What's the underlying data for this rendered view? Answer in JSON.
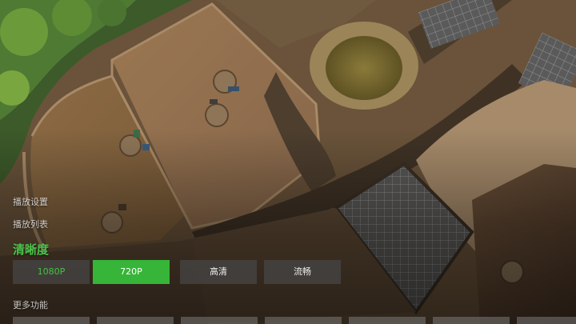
{
  "menu": {
    "playback_settings": "播放设置",
    "playlist": "播放列表",
    "resolution_title": "清晰度",
    "more_functions": "更多功能"
  },
  "resolution_options": [
    {
      "label": "1080P",
      "state": "current"
    },
    {
      "label": "720P",
      "state": "focused"
    },
    {
      "label": "高清",
      "state": "normal"
    },
    {
      "label": "流畅",
      "state": "normal"
    }
  ],
  "colors": {
    "accent_green": "#36b538",
    "current_text_green": "#43c440"
  }
}
